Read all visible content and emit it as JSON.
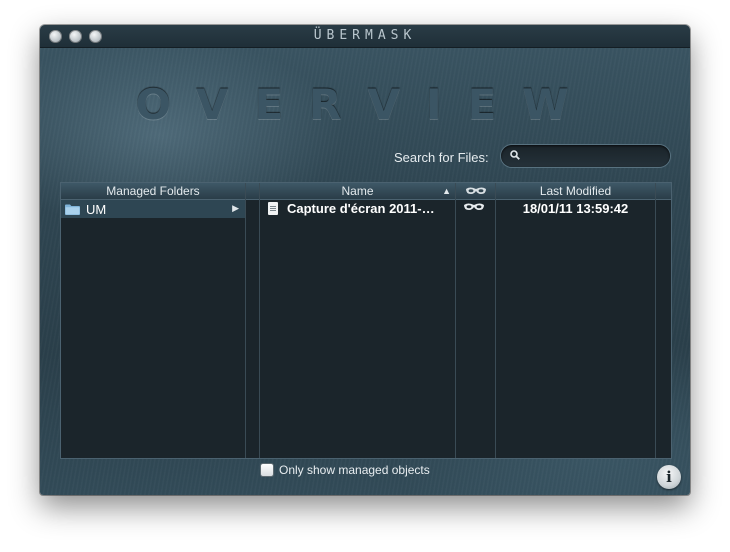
{
  "window": {
    "app_title": "ÜBERMASK",
    "heading": "OVERVIEW"
  },
  "search": {
    "label": "Search for Files:",
    "value": "",
    "placeholder": ""
  },
  "folders": {
    "header": "Managed Folders",
    "items": [
      {
        "label": "UM",
        "icon": "folder-icon"
      }
    ]
  },
  "files": {
    "columns": {
      "name": "Name",
      "masked": "mask-icon",
      "last_modified": "Last Modified"
    },
    "sort": {
      "column": "Name",
      "direction": "ascending"
    },
    "rows": [
      {
        "name": "Capture d'écran 2011-…",
        "masked": true,
        "last_modified": "18/01/11 13:59:42"
      }
    ]
  },
  "footer": {
    "checkbox_label": "Only show managed objects",
    "checkbox_checked": false,
    "info_label": "i"
  },
  "colors": {
    "window_bg": "#2f4652",
    "table_bg": "#1b252b",
    "selection": "#2e4653",
    "folder_blue": "#7fb3d8"
  }
}
